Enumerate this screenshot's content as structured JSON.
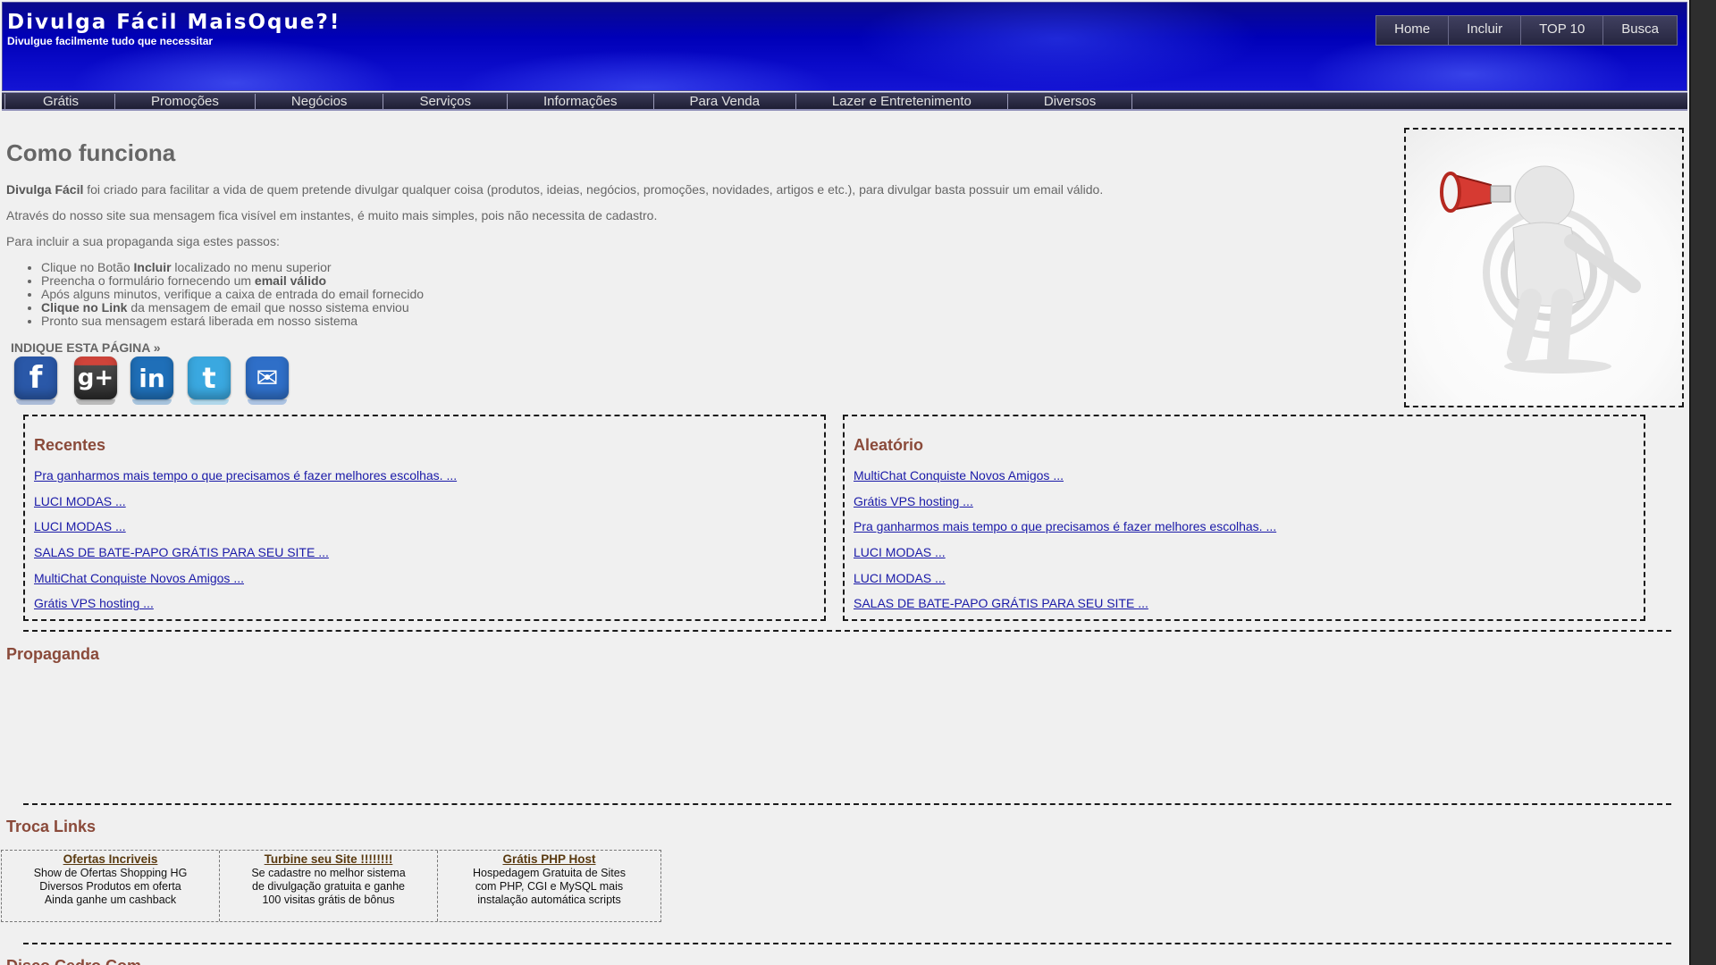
{
  "header": {
    "title": "Divulga Fácil MaisOque?!",
    "tagline": "Divulgue facilmente tudo que necessitar",
    "nav": [
      "Home",
      "Incluir",
      "TOP 10",
      "Busca"
    ]
  },
  "categories": [
    "Grátis",
    "Promoções",
    "Negócios",
    "Serviços",
    "Informações",
    "Para Venda",
    "Lazer e Entretenimento",
    "Diversos"
  ],
  "how": {
    "title": "Como funciona",
    "p1_bold": "Divulga Fácil",
    "p1_rest": " foi criado para facilitar a vida de quem pretende divulgar qualquer coisa (produtos, ideias, negócios, promoções, novidades, artigos e etc.), para divulgar basta possuir um email válido.",
    "p2": "Através do nosso site sua mensagem fica visível em instantes, é muito mais simples, pois não necessita de cadastro.",
    "p3": "Para incluir a sua propaganda siga estes passos:",
    "steps": [
      {
        "pre": "Clique no Botão ",
        "bold": "Incluir",
        "post": " localizado no menu superior"
      },
      {
        "pre": "Preencha o formulário fornecendo um ",
        "bold": "email válido",
        "post": ""
      },
      {
        "pre": "Após alguns minutos, verifique a caixa de entrada do email fornecido",
        "bold": "",
        "post": ""
      },
      {
        "pre": "",
        "bold": "Clique no Link",
        "post": " da mensagem de email que nosso sistema enviou"
      },
      {
        "pre": "Pronto sua mensagem estará liberada em nosso sistema",
        "bold": "",
        "post": ""
      }
    ],
    "share_label": "INDIQUE ESTA PÁGINA »"
  },
  "social": [
    {
      "icon": "facebook-icon",
      "glyph": "f",
      "color": "#2a58a8"
    },
    {
      "icon": "google-plus-icon",
      "glyph": "g+",
      "color": "#5a5a5a"
    },
    {
      "icon": "linkedin-icon",
      "glyph": "in",
      "color": "#1f6fb8"
    },
    {
      "icon": "twitter-icon",
      "glyph": "t",
      "color": "#3aa8e0"
    },
    {
      "icon": "email-icon",
      "glyph": "✉",
      "color": "#2f6fc8"
    }
  ],
  "recentes": {
    "title": "Recentes",
    "items": [
      "Pra ganharmos mais tempo o que precisamos é fazer melhores escolhas. ...",
      "LUCI MODAS ...",
      "LUCI MODAS ...",
      "SALAS DE BATE-PAPO GRÁTIS PARA SEU SITE ...",
      "MultiChat Conquiste Novos Amigos ...",
      "Grátis VPS hosting ..."
    ]
  },
  "aleatorio": {
    "title": "Aleatório",
    "items": [
      "MultiChat Conquiste Novos Amigos ...",
      "Grátis VPS hosting ...",
      "Pra ganharmos mais tempo o que precisamos é fazer melhores escolhas. ...",
      "LUCI MODAS ...",
      "LUCI MODAS ...",
      "SALAS DE BATE-PAPO GRÁTIS PARA SEU SITE ..."
    ]
  },
  "propaganda": {
    "title": "Propaganda"
  },
  "troca": {
    "title": "Troca Links",
    "links": [
      {
        "title": "Ofertas Incriveis",
        "lines": [
          "Show de Ofertas Shopping HG",
          "Diversos Produtos em oferta",
          "Ainda ganhe um cashback"
        ]
      },
      {
        "title": "Turbine seu Site !!!!!!!!",
        "lines": [
          "Se cadastre no melhor sistema",
          "de divulgação gratuita e ganhe",
          "100 visitas grátis de bônus"
        ]
      },
      {
        "title": "Grátis PHP Host",
        "lines": [
          "Hospedagem Gratuita de Sites",
          "com PHP, CGI e MySQL mais",
          "instalação automática scripts"
        ]
      }
    ]
  },
  "footer_section": {
    "title": "Disco Cedro Com"
  }
}
